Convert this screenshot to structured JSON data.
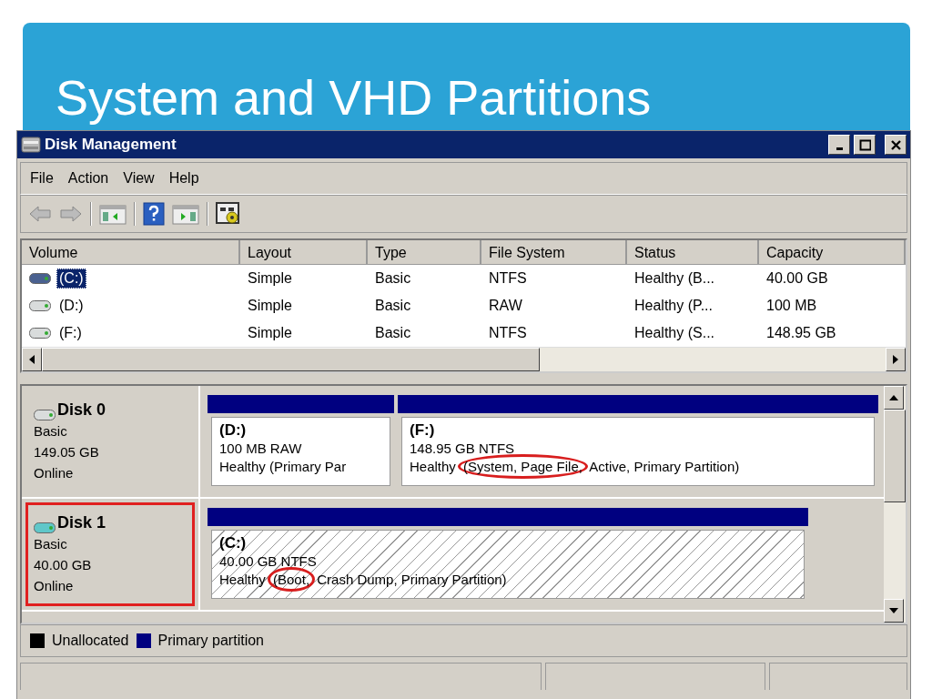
{
  "slide": {
    "title": "System and VHD Partitions"
  },
  "window": {
    "title": "Disk Management"
  },
  "menu": [
    "File",
    "Action",
    "View",
    "Help"
  ],
  "table": {
    "columns": [
      "Volume",
      "Layout",
      "Type",
      "File System",
      "Status",
      "Capacity"
    ],
    "rows": [
      {
        "cells": [
          "(C:)",
          "Simple",
          "Basic",
          "NTFS",
          "Healthy (B...",
          "40.00 GB"
        ],
        "selected": true
      },
      {
        "cells": [
          "(D:)",
          "Simple",
          "Basic",
          "RAW",
          "Healthy (P...",
          "100 MB"
        ],
        "selected": false
      },
      {
        "cells": [
          "(F:)",
          "Simple",
          "Basic",
          "NTFS",
          "Healthy (S...",
          "148.95 GB"
        ],
        "selected": false
      }
    ]
  },
  "disks": [
    {
      "name": "Disk 0",
      "kind": "physical",
      "type": "Basic",
      "size": "149.05 GB",
      "status": "Online",
      "highlighted": false,
      "partitions": [
        {
          "name": "(D:)",
          "info": "100 MB RAW",
          "selected": false,
          "status": [
            {
              "text": "Healthy (Primary Par",
              "circled": false
            }
          ]
        },
        {
          "name": "(F:)",
          "info": "148.95 GB NTFS",
          "selected": false,
          "status": [
            {
              "text": "Healthy",
              "circled": false
            },
            {
              "text": "(System, Page File,",
              "circled": true
            },
            {
              "text": "Active, Primary Partition)",
              "circled": false
            }
          ]
        }
      ]
    },
    {
      "name": "Disk 1",
      "kind": "virtual",
      "type": "Basic",
      "size": "40.00 GB",
      "status": "Online",
      "highlighted": true,
      "partitions": [
        {
          "name": "(C:)",
          "info": "40.00 GB NTFS",
          "selected": true,
          "status": [
            {
              "text": "Healthy",
              "circled": false
            },
            {
              "text": "(Boot,",
              "circled": true
            },
            {
              "text": "Crash Dump, Primary Partition)",
              "circled": false
            }
          ]
        }
      ]
    }
  ],
  "legend": [
    {
      "label": "Unallocated",
      "color": "#000000"
    },
    {
      "label": "Primary partition",
      "color": "#000080"
    }
  ]
}
